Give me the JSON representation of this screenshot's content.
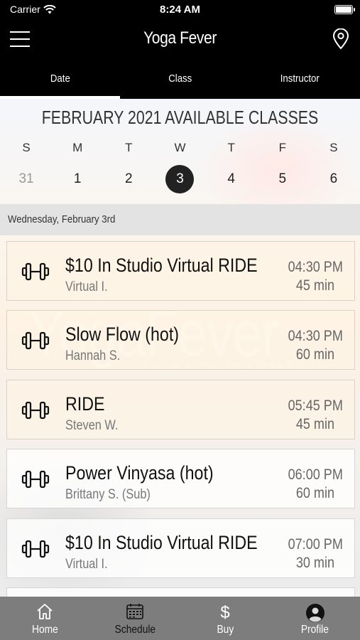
{
  "status_bar": {
    "carrier": "Carrier",
    "time": "8:24 AM"
  },
  "header": {
    "title": "Yoga Fever",
    "menu_icon": "hamburger-icon",
    "location_icon": "map-pin-icon"
  },
  "tabs": [
    {
      "label": "Date",
      "active": true
    },
    {
      "label": "Class",
      "active": false
    },
    {
      "label": "Instructor",
      "active": false
    }
  ],
  "calendar": {
    "month_title": "FEBRUARY 2021 AVAILABLE CLASSES",
    "day_names": [
      "S",
      "M",
      "T",
      "W",
      "T",
      "F",
      "S"
    ],
    "dates": [
      "31",
      "1",
      "2",
      "3",
      "4",
      "5",
      "6"
    ],
    "selected_date": "3",
    "faded_date": "31"
  },
  "selected_day_label": "Wednesday, February 3rd",
  "watermark": {
    "brand": "YogaFever",
    "tagline": "YOGA • CYCLE • STRENGTH"
  },
  "classes": [
    {
      "name": "$10 In Studio Virtual RIDE",
      "instructor": "Virtual I.",
      "time": "04:30 PM",
      "duration": "45 min"
    },
    {
      "name": "Slow Flow (hot)",
      "instructor": "Hannah S.",
      "time": "04:30 PM",
      "duration": "60 min"
    },
    {
      "name": "RIDE",
      "instructor": "Steven W.",
      "time": "05:45 PM",
      "duration": "45 min"
    },
    {
      "name": "Power Vinyasa (hot)",
      "instructor": "Brittany S. (Sub)",
      "time": "06:00 PM",
      "duration": "60 min"
    },
    {
      "name": "$10 In Studio Virtual RIDE",
      "instructor": "Virtual I.",
      "time": "07:00 PM",
      "duration": "30 min"
    }
  ],
  "bottom_nav": [
    {
      "label": "Home",
      "icon": "home-icon"
    },
    {
      "label": "Schedule",
      "icon": "calendar-icon"
    },
    {
      "label": "Buy",
      "icon": "dollar-icon"
    },
    {
      "label": "Profile",
      "icon": "profile-icon"
    }
  ],
  "colors": {
    "header_bg": "#000000",
    "nav_bg": "#7d7d7d",
    "selected_date_bg": "#222222",
    "card_bg": "#fdf4e5"
  }
}
